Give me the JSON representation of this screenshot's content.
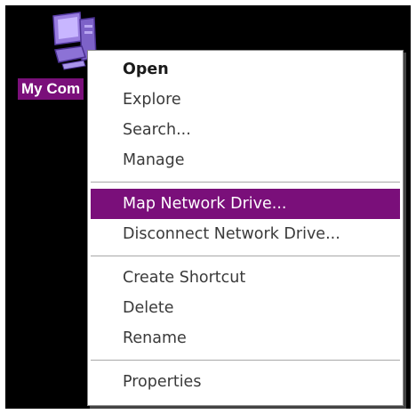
{
  "desktop": {
    "icon_name": "my-computer-icon",
    "icon_label": "My Com"
  },
  "context_menu": {
    "groups": [
      [
        {
          "label": "Open",
          "bold": true
        },
        {
          "label": "Explore"
        },
        {
          "label": "Search..."
        },
        {
          "label": "Manage"
        }
      ],
      [
        {
          "label": "Map Network Drive...",
          "highlighted": true
        },
        {
          "label": "Disconnect Network Drive..."
        }
      ],
      [
        {
          "label": "Create Shortcut"
        },
        {
          "label": "Delete"
        },
        {
          "label": "Rename"
        }
      ],
      [
        {
          "label": "Properties"
        }
      ]
    ]
  },
  "colors": {
    "highlight": "#7a0f7a",
    "background": "#000000",
    "menu_background": "#ffffff"
  }
}
